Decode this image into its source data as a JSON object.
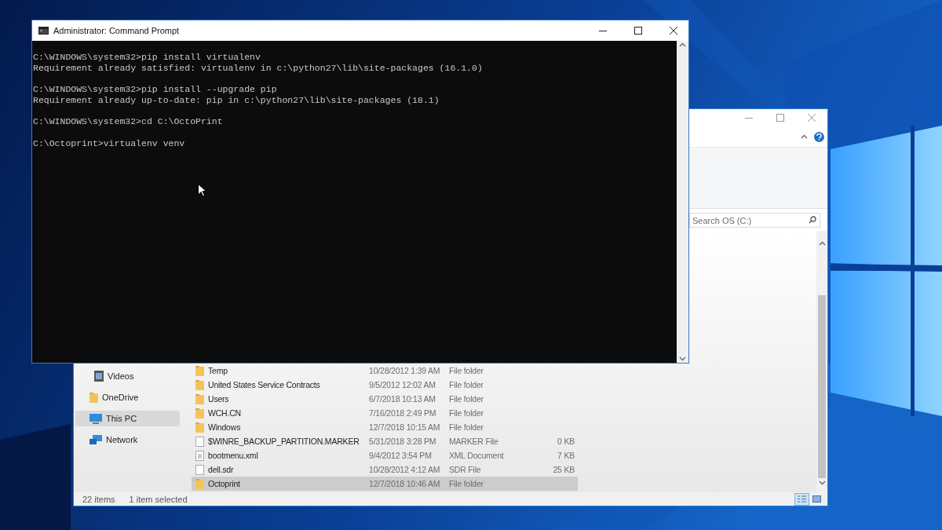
{
  "console": {
    "title": "Administrator: Command Prompt",
    "lines": [
      {
        "kind": "command",
        "text": "C:\\WINDOWS\\system32>pip install virtualenv"
      },
      {
        "kind": "output",
        "text": "Requirement already satisfied: virtualenv in c:\\python27\\lib\\site-packages (16.1.0)"
      },
      {
        "kind": "command",
        "text": "C:\\WINDOWS\\system32>pip install --upgrade pip"
      },
      {
        "kind": "output",
        "text": "Requirement already up-to-date: pip in c:\\python27\\lib\\site-packages (18.1)"
      },
      {
        "kind": "command",
        "text": "C:\\WINDOWS\\system32>cd C:\\OctoPrint"
      },
      {
        "kind": "command",
        "text": "C:\\Octoprint>virtualenv venv"
      }
    ]
  },
  "explorer": {
    "search": {
      "placeholder": "Search OS (C:)"
    },
    "nav": [
      {
        "label": "Videos",
        "kind": "videos",
        "selected": false
      },
      {
        "label": "OneDrive",
        "kind": "folder",
        "selected": false
      },
      {
        "label": "This PC",
        "kind": "pc",
        "selected": true
      },
      {
        "label": "Network",
        "kind": "network",
        "selected": false
      }
    ],
    "files": [
      {
        "name": "Temp",
        "date": "10/28/2012 1:39 AM",
        "type": "File folder",
        "kind": "folder",
        "selected": false
      },
      {
        "name": "United States Service Contracts",
        "date": "9/5/2012 12:02 AM",
        "type": "File folder",
        "kind": "folder",
        "selected": false
      },
      {
        "name": "Users",
        "date": "6/7/2018 10:13 AM",
        "type": "File folder",
        "kind": "folder",
        "selected": false
      },
      {
        "name": "WCH.CN",
        "date": "7/16/2018 2:49 PM",
        "type": "File folder",
        "kind": "folder",
        "selected": false
      },
      {
        "name": "Windows",
        "date": "12/7/2018 10:15 AM",
        "type": "File folder",
        "kind": "folder",
        "selected": false
      },
      {
        "name": "$WINRE_BACKUP_PARTITION.MARKER",
        "date": "5/31/2018 3:28 PM",
        "type": "MARKER File",
        "size": "0 KB",
        "kind": "file",
        "selected": false
      },
      {
        "name": "bootmenu.xml",
        "date": "9/4/2012 3:54 PM",
        "type": "XML Document",
        "size": "7 KB",
        "kind": "xml",
        "selected": false
      },
      {
        "name": "dell.sdr",
        "date": "10/28/2012 4:12 AM",
        "type": "SDR File",
        "size": "25 KB",
        "kind": "file",
        "selected": false
      },
      {
        "name": "Octoprint",
        "date": "12/7/2018 10:46 AM",
        "type": "File folder",
        "kind": "folder",
        "selected": true
      }
    ],
    "status": {
      "count": "22 items",
      "selection": "1 item selected"
    },
    "view_buttons": [
      {
        "kind": "details",
        "selected": true
      },
      {
        "kind": "thumbnails",
        "selected": false
      }
    ]
  }
}
